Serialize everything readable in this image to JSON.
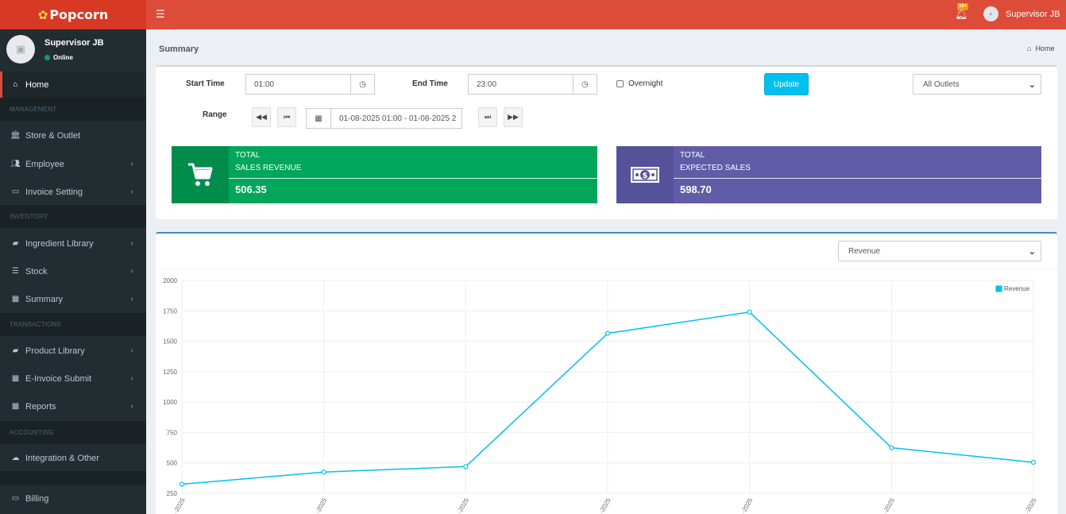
{
  "header": {
    "brand": "Popcorn",
    "notification_badge": "10+",
    "user_name": "Supervisor JB",
    "icons": {
      "menu": "hamburger-icon",
      "bell": "bell-icon",
      "avatar": "user-avatar-icon"
    }
  },
  "sidebar": {
    "user": {
      "name": "Supervisor JB",
      "status": "Online"
    },
    "home": {
      "label": "Home",
      "icon": "home-icon"
    },
    "sections": {
      "management": "MANAGEMENT",
      "inventory": "INVENTORY",
      "transactions": "TRANSACTIONS",
      "accounting": "ACCOUNTING"
    },
    "items": {
      "store_outlet": {
        "label": "Store & Outlet",
        "icon": "bank-icon"
      },
      "employee": {
        "label": "Employee",
        "icon": "users-icon"
      },
      "invoice_setting": {
        "label": "Invoice Setting",
        "icon": "money-icon"
      },
      "ingredient_library": {
        "label": "Ingredient Library",
        "icon": "book-icon"
      },
      "stock": {
        "label": "Stock",
        "icon": "database-icon"
      },
      "summary": {
        "label": "Summary",
        "icon": "table-icon"
      },
      "product_library": {
        "label": "Product Library",
        "icon": "book-icon"
      },
      "einvoice_submit": {
        "label": "E-Invoice Submit",
        "icon": "table-icon"
      },
      "reports": {
        "label": "Reports",
        "icon": "table-icon"
      },
      "integration": {
        "label": "Integration & Other",
        "icon": "cloud-icon"
      },
      "billing": {
        "label": "Billing",
        "icon": "credit-card-icon"
      }
    }
  },
  "content": {
    "title": "Summary",
    "breadcrumb_home": "Home"
  },
  "filters": {
    "start_time_label": "Start Time",
    "start_time_value": "01:00",
    "end_time_label": "End Time",
    "end_time_value": "23:00",
    "overnight_label": "Overnight",
    "overnight_checked": false,
    "update_label": "Update",
    "outlet_selected": "All Outlets",
    "range_label": "Range",
    "range_value": "01-08-2025 01:00 - 01-08-2025 2"
  },
  "cards": {
    "revenue": {
      "line1": "TOTAL",
      "line2": "SALES REVENUE",
      "value": "506.35",
      "color": "#00a65a",
      "icon_bg": "#008d4c",
      "icon": "shopping-cart-icon"
    },
    "expected": {
      "line1": "TOTAL",
      "line2": "EXPECTED SALES",
      "value": "598.70",
      "color": "#605ca8",
      "icon_bg": "#555299",
      "icon": "money-bill-icon"
    }
  },
  "chart_select": {
    "selected": "Revenue"
  },
  "chart_data": {
    "type": "line",
    "series": [
      {
        "name": "Revenue",
        "color": "#00c0ef",
        "values": [
          325,
          425,
          470,
          1565,
          1740,
          625,
          505
        ]
      }
    ],
    "x": [
      "…-2025",
      "…-2025",
      "…-2025",
      "…-2025",
      "…-2025",
      "…-2025",
      "…-2025"
    ],
    "ylim": [
      250,
      2000
    ],
    "yticks": [
      250,
      500,
      750,
      1000,
      1250,
      1500,
      1750,
      2000
    ],
    "grid": true,
    "legend": "top-right"
  }
}
